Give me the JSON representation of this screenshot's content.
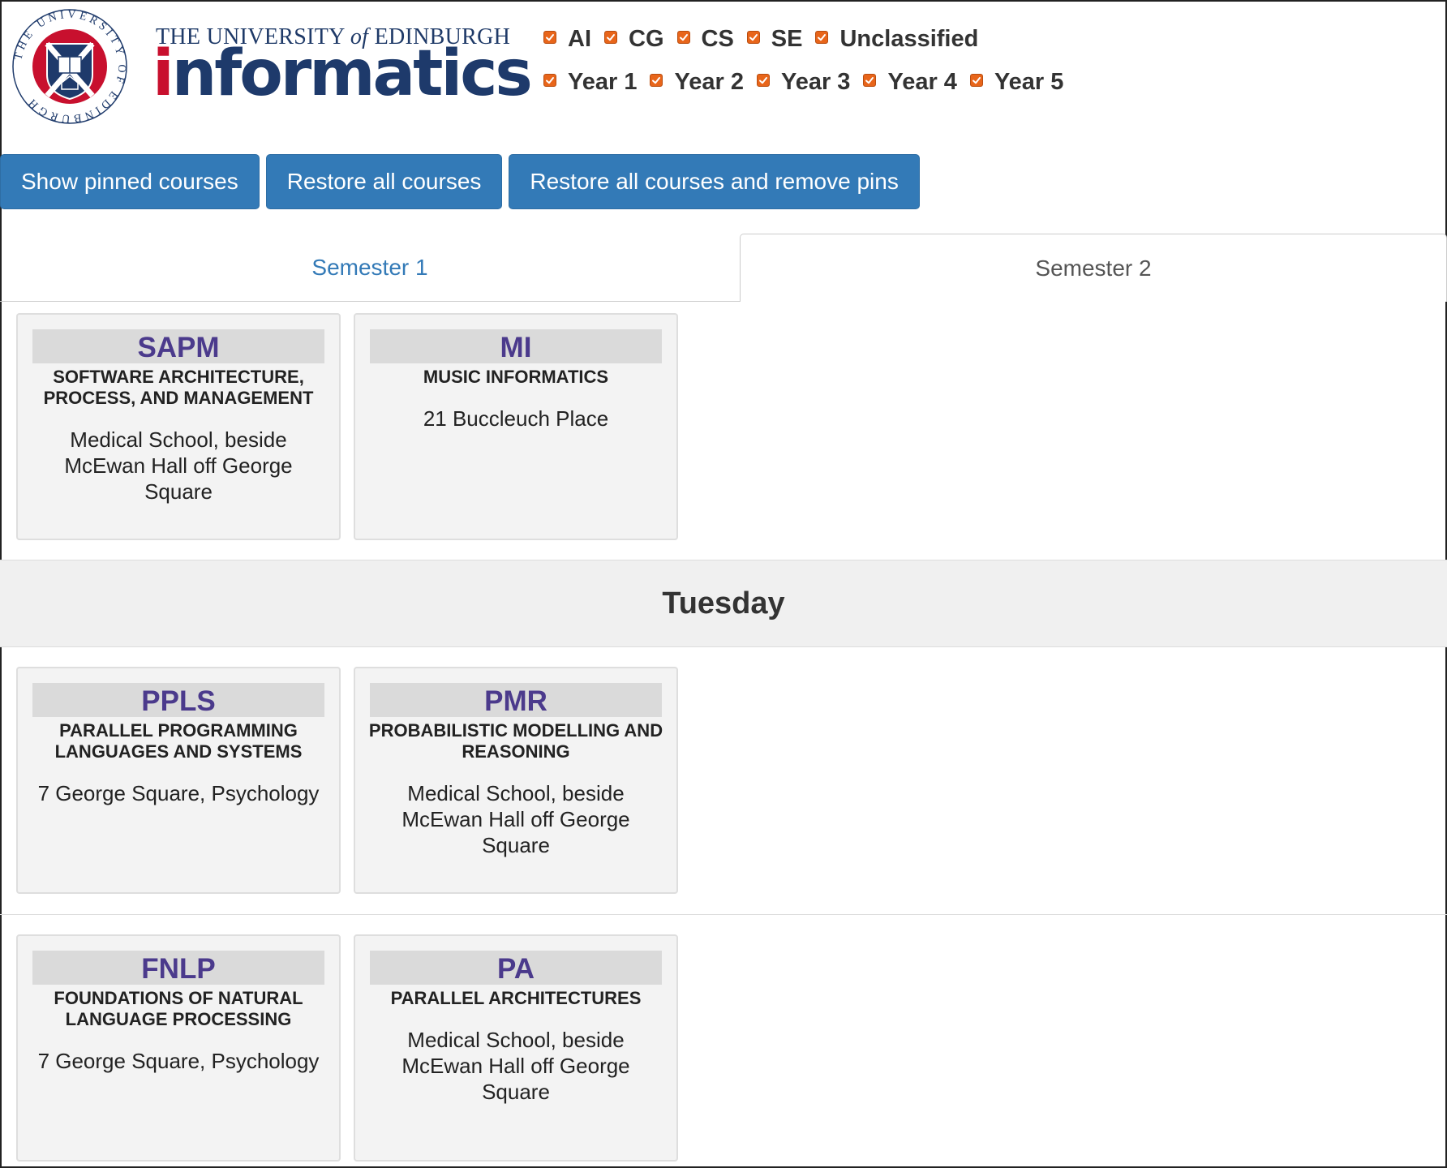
{
  "header": {
    "university_name_part1": "THE UNIVERSITY ",
    "university_name_of": "of",
    "university_name_part2": " EDINBURGH",
    "logo_word_i": "i",
    "logo_word_rest": "nformatics",
    "seal_text": "THE UNIVERSITY OF EDINBURGH"
  },
  "filters": {
    "subjects": [
      "AI",
      "CG",
      "CS",
      "SE",
      "Unclassified"
    ],
    "years": [
      "Year 1",
      "Year 2",
      "Year 3",
      "Year 4",
      "Year 5"
    ],
    "all_checked": true,
    "checkbox_color": "#e8651a"
  },
  "buttons": {
    "show_pinned": "Show pinned courses",
    "restore_all": "Restore all courses",
    "restore_remove_pins": "Restore all courses and remove pins",
    "color": "#337ab7"
  },
  "tabs": {
    "semester1": "Semester 1",
    "semester2": "Semester 2",
    "active": "Semester 2"
  },
  "day": "Tuesday",
  "courses": [
    {
      "code": "SAPM",
      "title": "Software Architecture, Process, and Management",
      "location": "Medical School, beside McEwan Hall off George Square"
    },
    {
      "code": "MI",
      "title": "Music Informatics",
      "location": "21 Buccleuch Place"
    },
    {
      "code": "PPLS",
      "title": "Parallel Programming Languages and Systems",
      "location": "7 George Square, Psychology"
    },
    {
      "code": "PMR",
      "title": "Probabilistic Modelling and Reasoning",
      "location": "Medical School, beside McEwan Hall off George Square"
    },
    {
      "code": "FNLP",
      "title": "Foundations of Natural Language Processing",
      "location": "7 George Square, Psychology"
    },
    {
      "code": "PA",
      "title": "Parallel Architectures",
      "location": "Medical School, beside McEwan Hall off George Square"
    }
  ]
}
